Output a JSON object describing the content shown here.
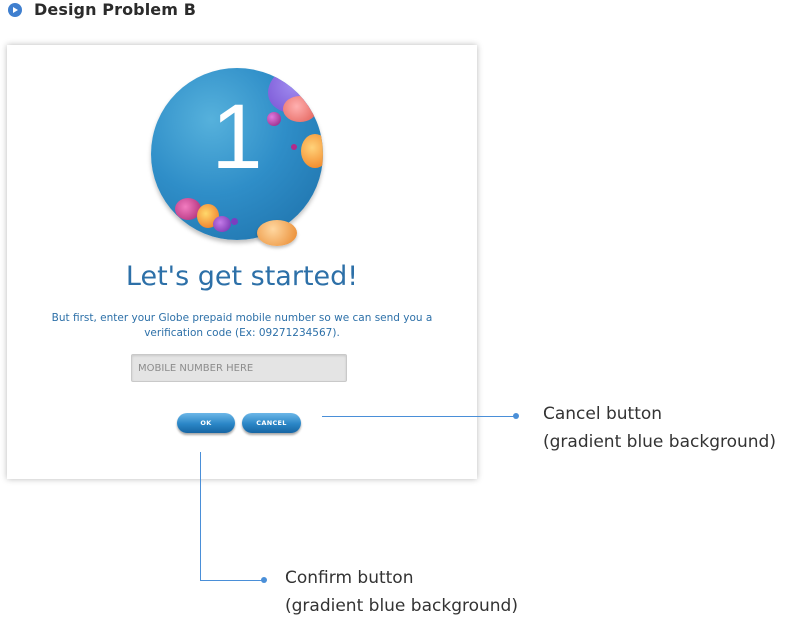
{
  "header": {
    "title": "Design Problem B",
    "icon": "play-circle-icon"
  },
  "dialog": {
    "step_number": "1",
    "heading": "Let's get started!",
    "description_line1": "But first, enter your Globe prepaid mobile number so we can send you a",
    "description_line2": "verification code (Ex: 09271234567).",
    "mobile_input": {
      "value": "",
      "placeholder": "MOBILE NUMBER HERE"
    },
    "ok_label": "OK",
    "cancel_label": "CANCEL"
  },
  "annotations": {
    "cancel": {
      "line1": "Cancel button",
      "line2": "(gradient blue background)"
    },
    "confirm": {
      "line1": "Confirm button",
      "line2": "(gradient blue background)"
    }
  },
  "colors": {
    "accent": "#2d70a8",
    "button_gradient_top": "#6cb7e8",
    "button_gradient_bottom": "#1765a3",
    "annotation_line": "#4a8fd8",
    "header_icon": "#3f7fcf"
  }
}
